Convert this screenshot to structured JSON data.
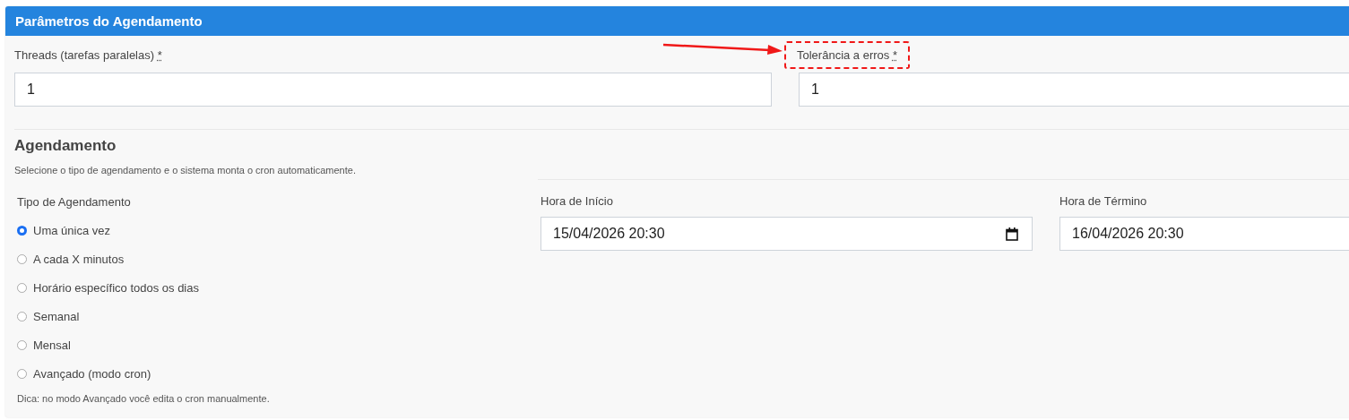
{
  "panel": {
    "title": "Parâmetros do Agendamento"
  },
  "fields": [
    {
      "label": "Threads (tarefas paralelas)",
      "required": true,
      "value": "1",
      "highlighted": false
    },
    {
      "label": "Tolerância a erros",
      "required": true,
      "value": "1",
      "highlighted": true
    }
  ],
  "required_mark": "*",
  "schedule": {
    "heading": "Agendamento",
    "description": "Selecione o tipo de agendamento e o sistema monta o cron automaticamente.",
    "type_label": "Tipo de Agendamento",
    "options": [
      {
        "label": "Uma única vez",
        "selected": true
      },
      {
        "label": "A cada X minutos",
        "selected": false
      },
      {
        "label": "Horário específico todos os dias",
        "selected": false
      },
      {
        "label": "Semanal",
        "selected": false
      },
      {
        "label": "Mensal",
        "selected": false
      },
      {
        "label": "Avançado (modo cron)",
        "selected": false
      }
    ],
    "tip": "Dica: no modo Avançado você edita o cron manualmente.",
    "times": [
      {
        "label": "Hora de Início",
        "value": "15/04/2026 20:30"
      },
      {
        "label": "Hora de Término",
        "value": "16/04/2026 20:30"
      }
    ]
  }
}
